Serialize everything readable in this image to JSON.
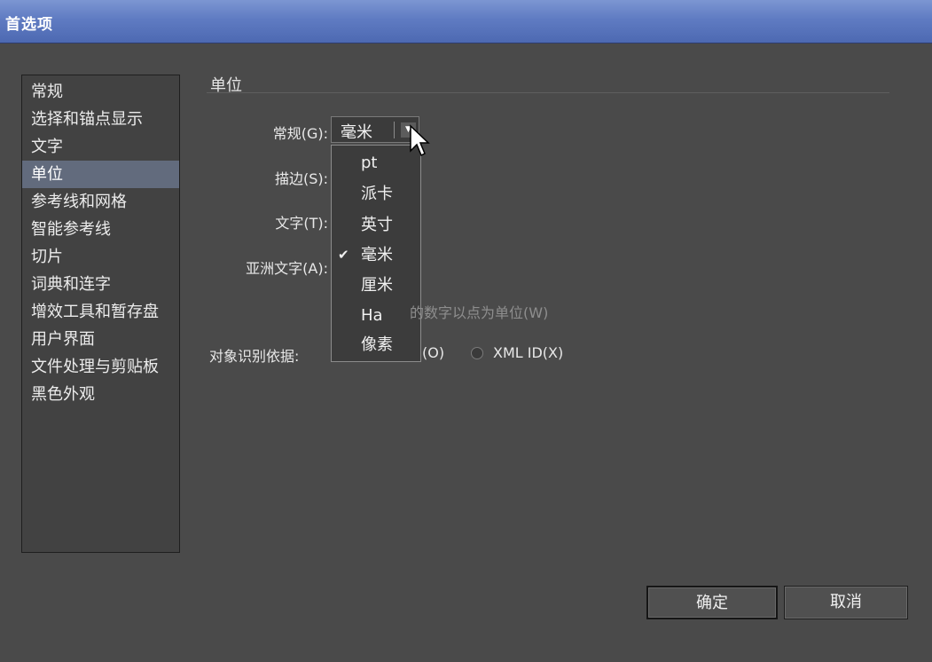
{
  "window": {
    "title": "首选项"
  },
  "sidebar": {
    "items": [
      {
        "label": "常规"
      },
      {
        "label": "选择和锚点显示"
      },
      {
        "label": "文字"
      },
      {
        "label": "单位"
      },
      {
        "label": "参考线和网格"
      },
      {
        "label": "智能参考线"
      },
      {
        "label": "切片"
      },
      {
        "label": "词典和连字"
      },
      {
        "label": "增效工具和暂存盘"
      },
      {
        "label": "用户界面"
      },
      {
        "label": "文件处理与剪贴板"
      },
      {
        "label": "黑色外观"
      }
    ],
    "selected": "单位"
  },
  "section": {
    "title": "单位"
  },
  "fields": {
    "general": {
      "label": "常规(G):",
      "value": "毫米"
    },
    "stroke": {
      "label": "描边(S):"
    },
    "type": {
      "label": "文字(T):"
    },
    "asian_type": {
      "label": "亚洲文字(A):"
    }
  },
  "dropdown": {
    "options": [
      "pt",
      "派卡",
      "英寸",
      "毫米",
      "厘米",
      "Ha",
      "像素"
    ],
    "checked": "毫米"
  },
  "hint_text": "的数字以点为单位(W)",
  "object_id": {
    "label": "对象识别依据:",
    "option1_partial": "(O)",
    "option2": "XML ID(X)"
  },
  "buttons": {
    "ok": "确定",
    "cancel": "取消"
  },
  "icons": {
    "dropdown_arrow": "triangle-down-icon",
    "check": "check-icon",
    "cursor": "mouse-pointer-icon"
  }
}
